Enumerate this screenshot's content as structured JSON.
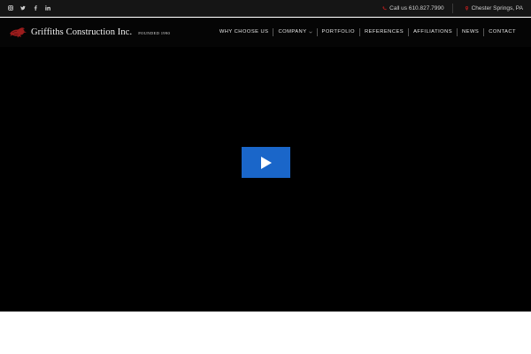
{
  "topbar": {
    "social": [
      {
        "name": "instagram-icon"
      },
      {
        "name": "twitter-icon"
      },
      {
        "name": "facebook-icon"
      },
      {
        "name": "linkedin-icon"
      }
    ],
    "phone_text": "Call us 610.827.7990",
    "location_text": "Chester Springs, PA"
  },
  "header": {
    "logo_name": "Griffiths Construction Inc.",
    "logo_tagline": "FOUNDED 1990",
    "nav": [
      {
        "label": "Why Choose Us"
      },
      {
        "label": "Company"
      },
      {
        "label": "Portfolio"
      },
      {
        "label": "References"
      },
      {
        "label": "Affiliations"
      },
      {
        "label": "News"
      },
      {
        "label": "Contact"
      }
    ]
  },
  "colors": {
    "topbar_bg": "#151515",
    "header_bg": "#050505",
    "hero_bg": "#000000",
    "play_button": "#1a66c9",
    "logo_accent": "#9b1c1c"
  }
}
